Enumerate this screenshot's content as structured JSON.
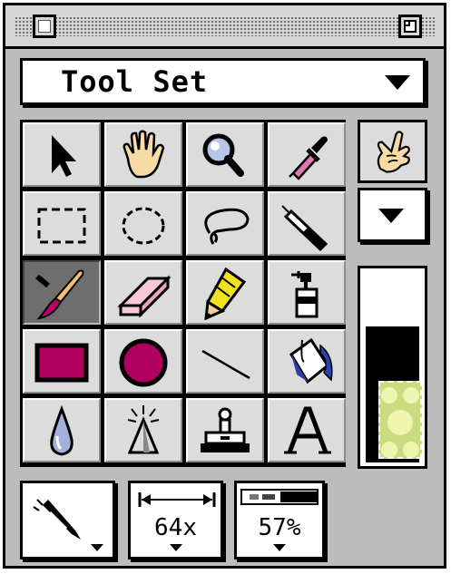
{
  "panel": {
    "title": "Tool Set"
  },
  "tools": [
    {
      "name": "arrow-tool",
      "icon": "arrow-icon"
    },
    {
      "name": "hand-tool",
      "icon": "hand-icon"
    },
    {
      "name": "magnify-tool",
      "icon": "magnifier-icon"
    },
    {
      "name": "eyedropper-tool",
      "icon": "eyedropper-icon"
    },
    {
      "name": "rect-marquee-tool",
      "icon": "rect-marquee-icon"
    },
    {
      "name": "ellipse-marquee-tool",
      "icon": "ellipse-marquee-icon"
    },
    {
      "name": "lasso-tool",
      "icon": "lasso-icon"
    },
    {
      "name": "syringe-tool",
      "icon": "syringe-icon"
    },
    {
      "name": "paintbrush-tool",
      "icon": "paintbrush-icon",
      "selected": true
    },
    {
      "name": "eraser-tool",
      "icon": "eraser-icon"
    },
    {
      "name": "pencil-tool",
      "icon": "pencil-icon"
    },
    {
      "name": "spray-tool",
      "icon": "spray-can-icon"
    },
    {
      "name": "filled-rect-tool",
      "icon": "filled-rect-icon"
    },
    {
      "name": "filled-oval-tool",
      "icon": "filled-oval-icon"
    },
    {
      "name": "line-tool",
      "icon": "line-icon"
    },
    {
      "name": "paint-bucket-tool",
      "icon": "paint-bucket-icon"
    },
    {
      "name": "water-drop-tool",
      "icon": "water-drop-icon"
    },
    {
      "name": "light-tool",
      "icon": "spotlight-icon"
    },
    {
      "name": "stamp-tool",
      "icon": "stamp-icon"
    },
    {
      "name": "text-tool",
      "icon": "text-icon"
    }
  ],
  "side": {
    "hand_icon": "pointing-hand-icon"
  },
  "bottom": {
    "brush_icon": "brush-icon",
    "size_value": "64x",
    "opacity_value": "57%"
  },
  "colors": {
    "selection": "#6e6e6e",
    "paint": "#c0006a",
    "foreground": "#c9dd7e",
    "background": "#000000"
  }
}
